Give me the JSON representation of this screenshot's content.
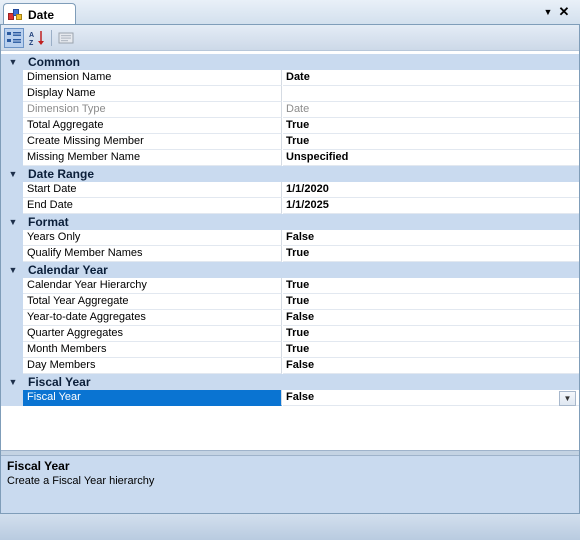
{
  "tab": {
    "title": "Date",
    "icon": "dimension-cube-icon"
  },
  "window_controls": {
    "dropdown_glyph": "▼",
    "close_glyph": "✕"
  },
  "toolbar": {
    "categorized": "categorized-icon",
    "alphabetical": "alphabetical-sort-icon",
    "property_pages": "property-pages-icon"
  },
  "grid": {
    "categories": [
      {
        "label": "Common",
        "rows": [
          {
            "name": "Dimension Name",
            "value": "Date"
          },
          {
            "name": "Display Name",
            "value": ""
          },
          {
            "name": "Dimension Type",
            "value": "Date",
            "readonly": true
          },
          {
            "name": "Total Aggregate",
            "value": "True"
          },
          {
            "name": "Create Missing Member",
            "value": "True"
          },
          {
            "name": "Missing Member Name",
            "value": "Unspecified"
          }
        ]
      },
      {
        "label": "Date Range",
        "rows": [
          {
            "name": "Start Date",
            "value": "1/1/2020"
          },
          {
            "name": "End Date",
            "value": "1/1/2025"
          }
        ]
      },
      {
        "label": "Format",
        "rows": [
          {
            "name": "Years Only",
            "value": "False"
          },
          {
            "name": "Qualify Member Names",
            "value": "True"
          }
        ]
      },
      {
        "label": "Calendar Year",
        "rows": [
          {
            "name": "Calendar Year Hierarchy",
            "value": "True"
          },
          {
            "name": "Total Year Aggregate",
            "value": "True"
          },
          {
            "name": "Year-to-date Aggregates",
            "value": "False"
          },
          {
            "name": "Quarter Aggregates",
            "value": "True"
          },
          {
            "name": "Month Members",
            "value": "True"
          },
          {
            "name": "Day Members",
            "value": "False"
          }
        ]
      },
      {
        "label": "Fiscal Year",
        "rows": [
          {
            "name": "Fiscal Year",
            "value": "False",
            "selected": true
          }
        ]
      }
    ]
  },
  "description": {
    "title": "Fiscal Year",
    "text": "Create a Fiscal Year hierarchy"
  },
  "colors": {
    "selection": "#0a74d2",
    "category_band": "#c9daef",
    "frame_border": "#7f9db9"
  }
}
